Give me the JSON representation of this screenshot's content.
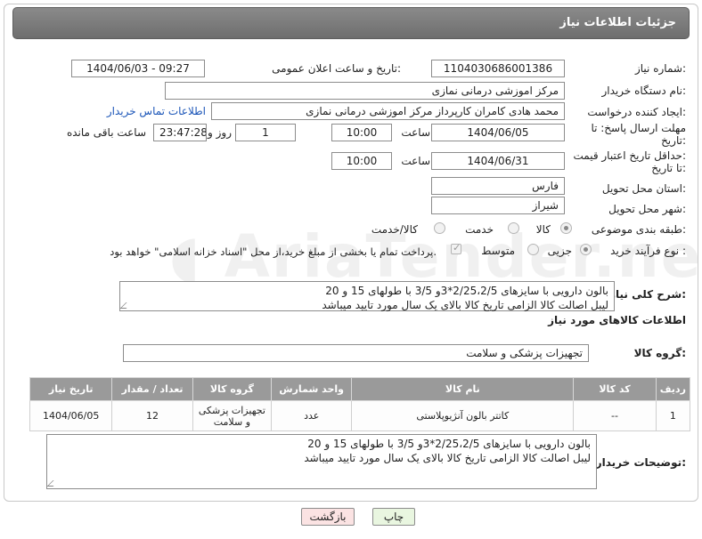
{
  "header": {
    "title": "جزئیات اطلاعات نیاز"
  },
  "fields": {
    "need_number_label": "شماره نیاز:",
    "need_number": "1104030686001386",
    "announce_label": "تاریخ و ساعت اعلان عمومی:",
    "announce_value": "1404/06/03 - 09:27",
    "buyer_org_label": "نام دستگاه خریدار:",
    "buyer_org": "مرکز اموزشی درمانی نمازی",
    "creator_label": "ایجاد کننده درخواست:",
    "creator": "محمد هادی کامران کارپرداز مرکز اموزشی درمانی نمازی",
    "contact_link": "اطلاعات تماس خریدار",
    "deadline_label_1": "مهلت ارسال پاسخ: تا",
    "deadline_label_2": "تاریخ:",
    "deadline_date": "1404/06/05",
    "deadline_time_label": "ساعت",
    "deadline_time": "10:00",
    "days": "1",
    "days_label": "روز و",
    "remaining_time": "23:47:28",
    "remaining_label": "ساعت باقی مانده",
    "price_label_1": "حداقل تاریخ اعتبار قیمت:",
    "price_label_2": "تا تاریخ:",
    "price_date": "1404/06/31",
    "price_time_label": "ساعت",
    "price_time": "10:00",
    "province_label": "استان محل تحویل:",
    "province": "فارس",
    "city_label": "شهر محل تحویل:",
    "city": "شیراز",
    "category_label": "طبقه بندی موضوعی:",
    "category_options": [
      "کالا",
      "خدمت",
      "کالا/خدمت"
    ],
    "process_label": "نوع فرآیند خرید :",
    "process_options": [
      "جزیی",
      "متوسط"
    ],
    "payment_note": "پرداخت تمام یا بخشی از مبلغ خرید،از محل \"اسناد خزانه اسلامی\" خواهد بود."
  },
  "summary": {
    "label": "شرح کلی نیاز:",
    "line1": "بالون دارویی با سایزهای 2/25،2/5*3و 3/5 با طولهای 15 و 20",
    "line2": "لیبل اصالت کالا الزامی تاریخ کالا بالای یک سال مورد تایید میباشد"
  },
  "goods_info": {
    "title": "اطلاعات کالاهای مورد نیاز"
  },
  "goods_group": {
    "label": "گروه کالا:",
    "value": "تجهیزات پزشکی و سلامت"
  },
  "table": {
    "headers": [
      "ردیف",
      "کد کالا",
      "نام کالا",
      "واحد شمارش",
      "گروه کالا",
      "تعداد / مقدار",
      "تاریخ نیاز"
    ],
    "rows": [
      [
        "1",
        "--",
        "کاتتر بالون آنژیوپلاستی",
        "عدد",
        "تجهیزات پزشکی و سلامت",
        "12",
        "1404/06/05"
      ]
    ]
  },
  "buyer_notes": {
    "label": "توضیحات خریدار:",
    "line1": "بالون دارویی با سایزهای 2/25،2/5*3و 3/5 با طولهای 15 و 20",
    "line2": "لیبل اصالت کالا الزامی تاریخ کالا بالای یک سال مورد تایید میباشد"
  },
  "buttons": {
    "print": "چاپ",
    "back": "بازگشت"
  },
  "colors": {
    "header_bg": "#7c7c7c",
    "table_header_bg": "#9a9a9a",
    "back_button_bg": "#fbe3e3",
    "print_button_bg": "#e9f6e0",
    "link": "#1c56b8"
  }
}
